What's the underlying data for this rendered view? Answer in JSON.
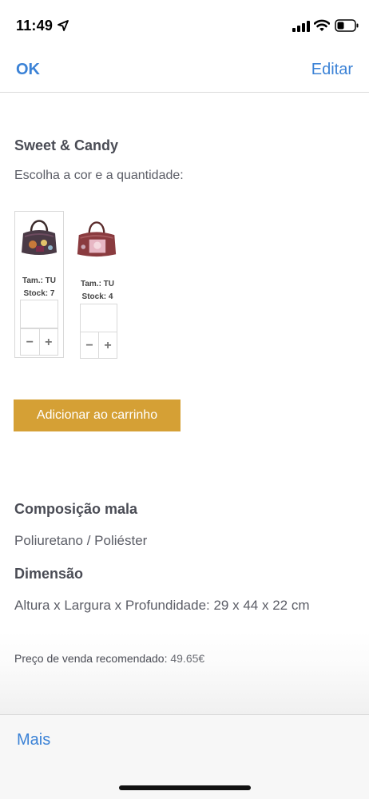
{
  "status_bar": {
    "time": "11:49",
    "icons": [
      "location-arrow-icon",
      "cellular-signal-icon",
      "wifi-icon",
      "battery-icon"
    ]
  },
  "nav": {
    "ok_label": "OK",
    "edit_label": "Editar"
  },
  "product": {
    "title": "Sweet & Candy",
    "choose_text": "Escolha a cor e a quantidade:",
    "variants": [
      {
        "size": "Tam.: TU",
        "stock": "Stock: 7",
        "quantity": ""
      },
      {
        "size": "Tam.: TU",
        "stock": "Stock: 4",
        "quantity": ""
      }
    ],
    "stepper_minus": "−",
    "stepper_plus": "+",
    "add_to_cart": "Adicionar ao carrinho"
  },
  "details": {
    "composition_heading": "Composição mala",
    "composition_value": "Poliuretano / Poliéster",
    "dimension_heading": "Dimensão",
    "dimension_value": "Altura x Largura x Profundidade: 29 x 44 x 22 cm",
    "price_label": "Preço de venda recomendado:",
    "price_value": "49.65€"
  },
  "toolbar": {
    "more_label": "Mais"
  },
  "colors": {
    "accent_blue": "#3b82d6",
    "button_gold": "#d5a035"
  }
}
